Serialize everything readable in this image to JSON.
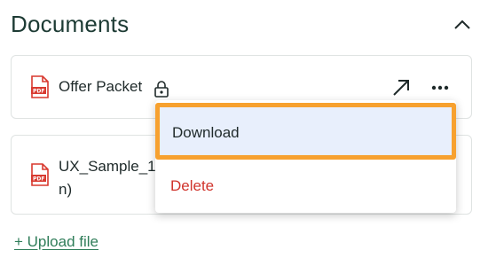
{
  "section": {
    "title": "Documents",
    "collapse_icon": "chevron-up-icon"
  },
  "documents": [
    {
      "name": "Offer Packet",
      "type_icon": "pdf-file-icon",
      "locked": true,
      "actions": [
        "open-external-icon",
        "more-options-icon"
      ]
    },
    {
      "name": "UX_Sample_1 n)",
      "type_icon": "pdf-file-icon",
      "locked": false
    }
  ],
  "menu": {
    "download_label": "Download",
    "delete_label": "Delete"
  },
  "upload": {
    "label": "+ Upload file"
  },
  "colors": {
    "title": "#1d3b34",
    "pdf_red": "#d8392f",
    "delete_red": "#d0342c",
    "link_green": "#2f7d59",
    "highlight_border": "#f7a12f",
    "highlight_fill": "#e8effc"
  }
}
